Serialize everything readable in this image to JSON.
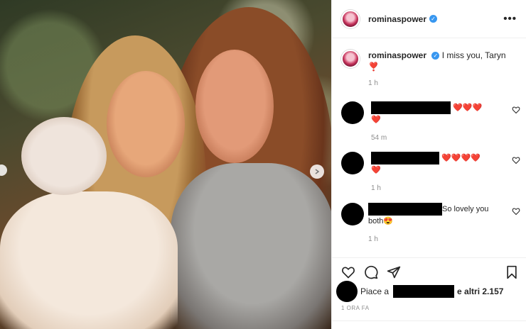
{
  "post": {
    "photo_description_icon": "photo",
    "nav_prev_icon": "chevron-left-icon",
    "nav_next_icon": "chevron-right-icon"
  },
  "header": {
    "username": "rominaspower",
    "verified_icon": "verified-badge-icon",
    "more_icon": "more-options-icon"
  },
  "caption": {
    "username": "rominaspower",
    "text": "I miss you, Taryn",
    "emoji": "❣️",
    "time": "1 h"
  },
  "comments": [
    {
      "hearts_line1": "❤️❤️❤️",
      "hearts_line2": "❤️",
      "time": "54 m"
    },
    {
      "hearts_line1": "❤️❤️❤️❤️",
      "hearts_line2": "❤️",
      "time": "1 h"
    },
    {
      "text": "So lovely you",
      "text2": "both😍",
      "time": "1 h"
    }
  ],
  "actions": {
    "like_icon": "heart-icon",
    "comment_icon": "comment-icon",
    "share_icon": "share-icon",
    "save_icon": "bookmark-icon"
  },
  "likes": {
    "prefix": "Piace a",
    "suffix": "e altri 2.157"
  },
  "posted": "1 ORA FA",
  "colors": {
    "verified": "#3897f0",
    "muted": "#8e8e8e",
    "heart": "#ed4956"
  }
}
